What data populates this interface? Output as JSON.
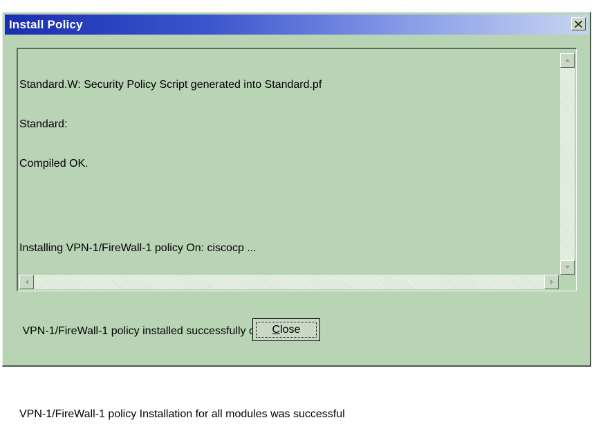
{
  "window": {
    "title": "Install Policy",
    "close_glyph": "x"
  },
  "log": {
    "lines": [
      "Standard.W: Security Policy Script generated into Standard.pf",
      "Standard:",
      "Compiled OK.",
      "",
      "Installing VPN-1/FireWall-1 policy On: ciscocp ...",
      "",
      " VPN-1/FireWall-1 policy installed successfully on ciscocp...",
      "",
      "VPN-1/FireWall-1 policy Installation for all modules was successful"
    ]
  },
  "buttons": {
    "close_label_mnemonic": "C",
    "close_label_rest": "lose"
  },
  "icons": {
    "scroll_up": "arrow-up-icon",
    "scroll_down": "arrow-down-icon",
    "scroll_left": "arrow-left-icon",
    "scroll_right": "arrow-right-icon",
    "close": "close-icon"
  }
}
